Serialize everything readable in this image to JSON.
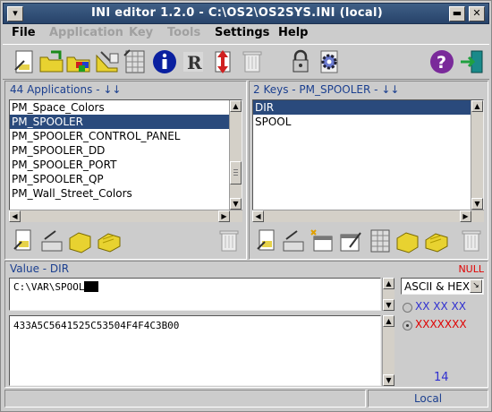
{
  "window": {
    "title": "INI editor 1.2.0 - C:\\OS2\\OS2SYS.INI (local)"
  },
  "menubar": {
    "file": "File",
    "application": "Application",
    "key": "Key",
    "tools": "Tools",
    "settings": "Settings",
    "help": "Help"
  },
  "toolbar": {
    "icons": [
      "new-ini-icon",
      "open-folder-icon",
      "open-color-icon",
      "edit-icon",
      "grid-icon",
      "info-icon",
      "registry-icon",
      "refresh-icon",
      "trash-icon",
      "lock-icon",
      "settings-cog-icon",
      "help-icon",
      "exit-icon"
    ]
  },
  "applications": {
    "header": "44 Applications - ↓↓",
    "items": [
      "PM_Space_Colors",
      "PM_SPOOLER",
      "PM_SPOOLER_CONTROL_PANEL",
      "PM_SPOOLER_DD",
      "PM_SPOOLER_PORT",
      "PM_SPOOLER_QP",
      "PM_Wall_Street_Colors"
    ],
    "selected_index": 1
  },
  "keys": {
    "header": "2 Keys - PM_SPOOLER - ↓↓",
    "items": [
      "DIR",
      "SPOOL"
    ],
    "selected_index": 0
  },
  "value": {
    "header": "Value - DIR",
    "null_label": "NULL",
    "text": "C:\\VAR\\SPOOL",
    "hex": "433A5C5641525C53504F4F4C3B00",
    "format": "ASCII & HEX",
    "option_hex_spaced": "XX XX XX",
    "option_hex_compact": "XXXXXXX",
    "length": "14"
  },
  "status": {
    "message": "",
    "mode": "Local"
  },
  "colors": {
    "selection": "#2a4a7c",
    "label_blue": "#1b3f8f",
    "null_red": "#e00000",
    "help_purple": "#7a2a9a"
  }
}
